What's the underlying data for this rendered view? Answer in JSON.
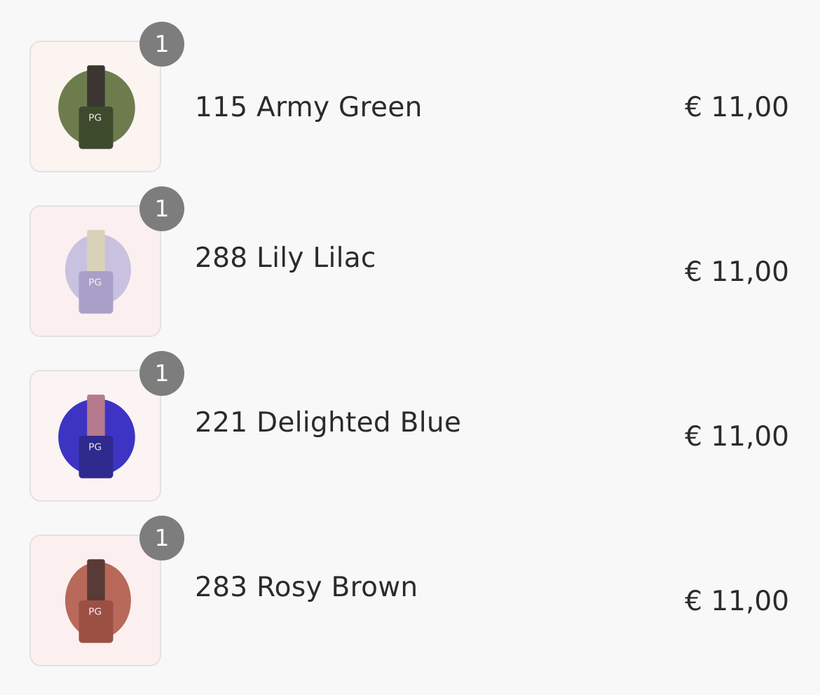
{
  "order_items": [
    {
      "quantity": "1",
      "name": "115 Army Green",
      "price": "€ 11,00",
      "swatch_color": "#6e7c4d",
      "bottle_color": "#3e4a2c",
      "cap_color": "#3b3632",
      "thumb_bg": "#fbf4f1"
    },
    {
      "quantity": "1",
      "name": "288 Lily Lilac",
      "price": "€ 11,00",
      "swatch_color": "#c9c1e0",
      "bottle_color": "#a99fc9",
      "cap_color": "#d9d2b8",
      "thumb_bg": "#fbf0ef"
    },
    {
      "quantity": "1",
      "name": "221 Delighted Blue",
      "price": "€ 11,00",
      "swatch_color": "#3d34c4",
      "bottle_color": "#2f2a8e",
      "cap_color": "#b57a8e",
      "thumb_bg": "#fbf4f2"
    },
    {
      "quantity": "1",
      "name": "283 Rosy Brown",
      "price": "€ 11,00",
      "swatch_color": "#b8695a",
      "bottle_color": "#9c5043",
      "cap_color": "#5a3a36",
      "thumb_bg": "#fbf0ef"
    }
  ],
  "product_image_icon": "nail-polish-bottle",
  "badge_color": "#7d7d7d"
}
